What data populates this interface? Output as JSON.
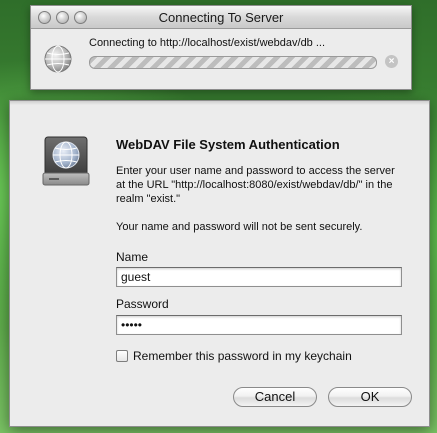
{
  "progress_window": {
    "title": "Connecting To Server",
    "status_text": "Connecting to http://localhost/exist/webdav/db ...",
    "progress": 0,
    "stop_icon": "×"
  },
  "auth_dialog": {
    "heading": "WebDAV File System Authentication",
    "message": "Enter your user name and password to access the server at the URL \"http://localhost:8080/exist/webdav/db/\" in the realm \"exist.\"",
    "warning": "Your name and password will not be sent securely.",
    "name_label": "Name",
    "name_value": "guest",
    "password_label": "Password",
    "password_value": "guest",
    "remember_label": "Remember this password in my keychain",
    "remember_checked": false,
    "cancel_label": "Cancel",
    "ok_label": "OK"
  },
  "icons": {
    "globe": "globe-icon",
    "drive": "network-drive-icon",
    "stop": "stop-icon"
  },
  "colors": {
    "window_bg": "#ececec",
    "desktop_green": "#4f9a41"
  }
}
